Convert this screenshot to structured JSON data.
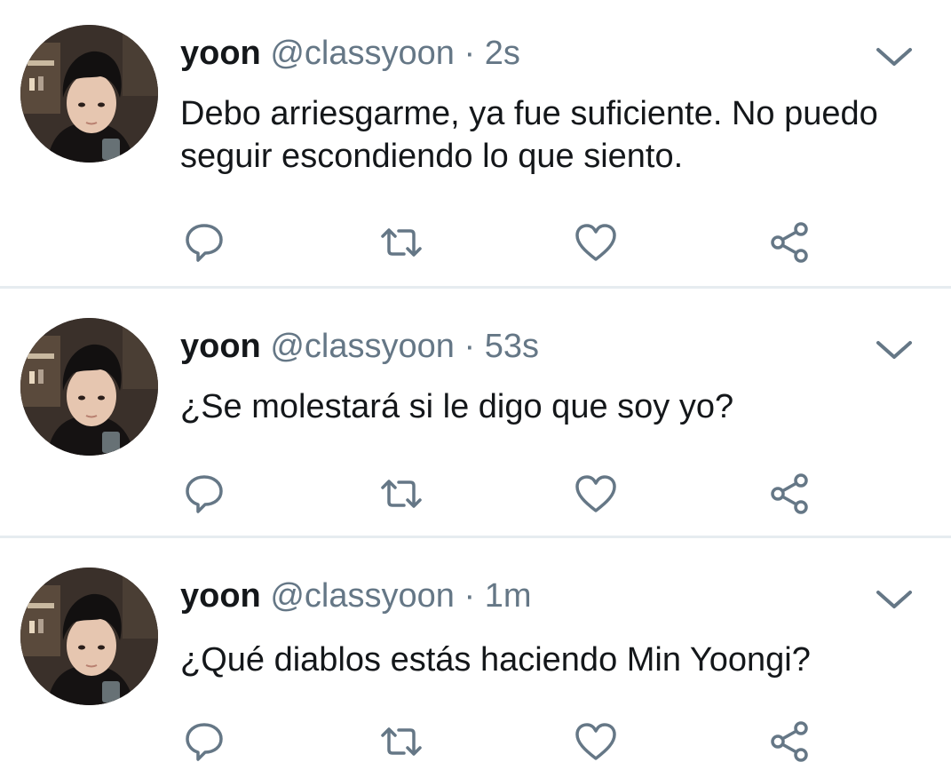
{
  "tweets": [
    {
      "name": "yoon",
      "handle": "@classyoon",
      "separator": "·",
      "time": "2s",
      "text": "Debo arriesgarme, ya fue suficiente. No puedo seguir escondiendo lo que siento."
    },
    {
      "name": "yoon",
      "handle": "@classyoon",
      "separator": "·",
      "time": "53s",
      "text": "¿Se molestará si le digo que soy yo?"
    },
    {
      "name": "yoon",
      "handle": "@classyoon",
      "separator": "·",
      "time": "1m",
      "text": "¿Qué diablos estás haciendo Min Yoongi?"
    }
  ],
  "icons": {
    "reply": "reply-icon",
    "retweet": "retweet-icon",
    "like": "like-icon",
    "share": "share-icon",
    "menu": "chevron-down-icon"
  },
  "colors": {
    "text": "#14171a",
    "secondary": "#657786",
    "icon": "#657786",
    "divider": "#e6ecf0",
    "background": "#ffffff"
  }
}
